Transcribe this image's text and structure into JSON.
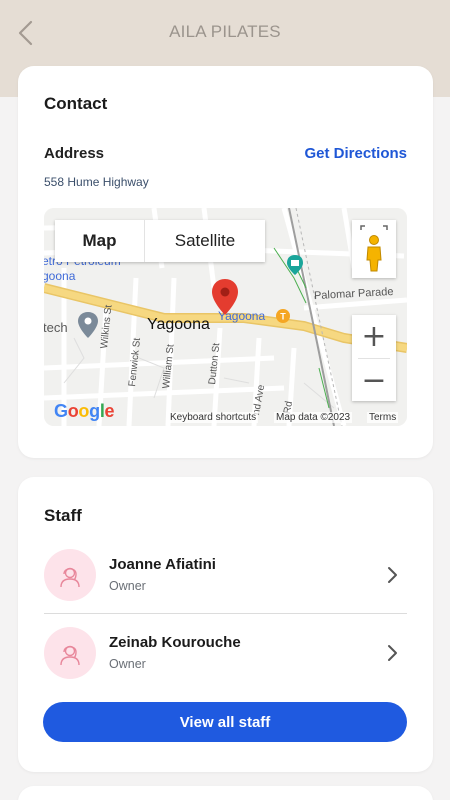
{
  "header": {
    "title": "AILA PILATES",
    "back_icon": "chevron-left-icon"
  },
  "contact": {
    "heading": "Contact",
    "address_label": "Address",
    "directions_label": "Get Directions",
    "address_value": "558 Hume Highway",
    "map": {
      "map_tab": "Map",
      "satellite_tab": "Satellite",
      "labels": {
        "poi_petroleum": "etro Petroleum",
        "poi_goona": "goona",
        "poi_tech": "tech",
        "poi_yagoona_station": "Yagoona",
        "place_yagoona": "Yagoona",
        "palomar": "Palomar Parade",
        "wilkins": "Wilkins St",
        "fenwick": "Fenwick St",
        "william": "William St",
        "dutton": "Dutton St",
        "nd_ave": "nd Ave",
        "rd": "Rd"
      },
      "zoom_in": "+",
      "zoom_out": "−",
      "google": "Google",
      "keyboard": "Keyboard shortcuts",
      "mapdata": "Map data ©2023",
      "terms": "Terms"
    }
  },
  "staff": {
    "heading": "Staff",
    "members": [
      {
        "name": "Joanne Afiatini",
        "role": "Owner"
      },
      {
        "name": "Zeinab Kourouche",
        "role": "Owner"
      }
    ],
    "view_all": "View all staff"
  },
  "colors": {
    "accent": "#1f5ae0",
    "header_bg": "#e5ddd4",
    "avatar_bg": "#fde3ea"
  }
}
